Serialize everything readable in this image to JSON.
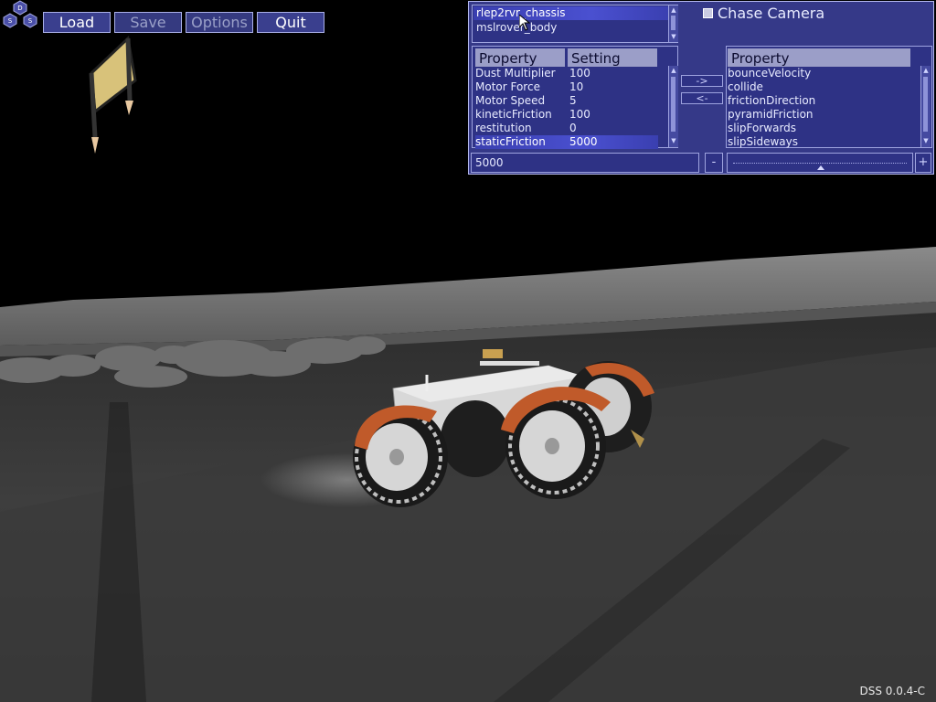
{
  "app": {
    "logo_letters": [
      "D",
      "S",
      "S"
    ],
    "version": "DSS 0.0.4-C"
  },
  "toolbar": {
    "load_label": "Load",
    "save_label": "Save",
    "options_label": "Options",
    "quit_label": "Quit"
  },
  "panel": {
    "objects": [
      "rlep2rvr_chassis",
      "mslrover_body"
    ],
    "selected_object": "rlep2rvr_chassis",
    "chase_camera_label": "Chase Camera",
    "chase_camera_checked": false,
    "left_headers": {
      "property": "Property",
      "setting": "Setting"
    },
    "left_rows": [
      {
        "property": "Dust Multiplier",
        "setting": "100"
      },
      {
        "property": "Motor Force",
        "setting": "10"
      },
      {
        "property": "Motor Speed",
        "setting": "5"
      },
      {
        "property": "kineticFriction",
        "setting": "100"
      },
      {
        "property": "restitution",
        "setting": "0"
      },
      {
        "property": "staticFriction",
        "setting": "5000"
      }
    ],
    "selected_left_row": "staticFriction",
    "add_button": "->",
    "remove_button": "<-",
    "right_header": "Property",
    "right_rows": [
      "bounceVelocity",
      "collide",
      "frictionDirection",
      "pyramidFriction",
      "slipForwards",
      "slipSideways"
    ],
    "value_field": "5000",
    "minus_label": "-",
    "plus_label": "+",
    "slider_fraction": 0.5
  },
  "colors": {
    "panel_bg": "#3a3e94",
    "button_bg": "#3a3f8e",
    "rover_fender": "#c05a2a",
    "lunar_ground": "#3a3a3a"
  },
  "icons": {
    "logo": "dss-hex-logo-icon",
    "cursor": "mouse-pointer-icon"
  }
}
